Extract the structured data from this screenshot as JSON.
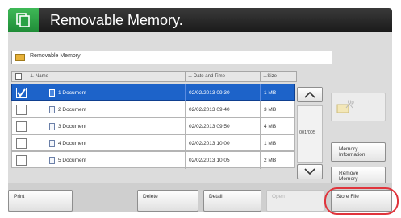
{
  "header": {
    "title": "Removable Memory."
  },
  "path": {
    "label": "Removable Memory"
  },
  "table": {
    "columns": [
      "Name",
      "Date and Time",
      "Size"
    ],
    "rows": [
      {
        "name": "1 Document",
        "date": "02/02/2013 09:30",
        "size": "1 MB",
        "selected": true
      },
      {
        "name": "2 Document",
        "date": "02/02/2013 09:40",
        "size": "3 MB",
        "selected": false
      },
      {
        "name": "3 Document",
        "date": "02/02/2013 09:50",
        "size": "4 MB",
        "selected": false
      },
      {
        "name": "4 Document",
        "date": "02/02/2013 10:00",
        "size": "1 MB",
        "selected": false
      },
      {
        "name": "5 Document",
        "date": "02/02/2013 10:05",
        "size": "2 MB",
        "selected": false
      }
    ]
  },
  "scroll": {
    "page": "001/005"
  },
  "side": {
    "up_label": "Up",
    "memory_info": [
      "Memory",
      "Information"
    ],
    "remove_memory": [
      "Remove",
      "Memory"
    ]
  },
  "bottom": {
    "print": "Print",
    "delete": "Delete",
    "detail": "Detail",
    "open": "Open",
    "store_file": "Store File"
  },
  "colors": {
    "accent_green": "#2aa245",
    "selection_blue": "#1d63c9",
    "highlight_red": "#e0343c"
  }
}
